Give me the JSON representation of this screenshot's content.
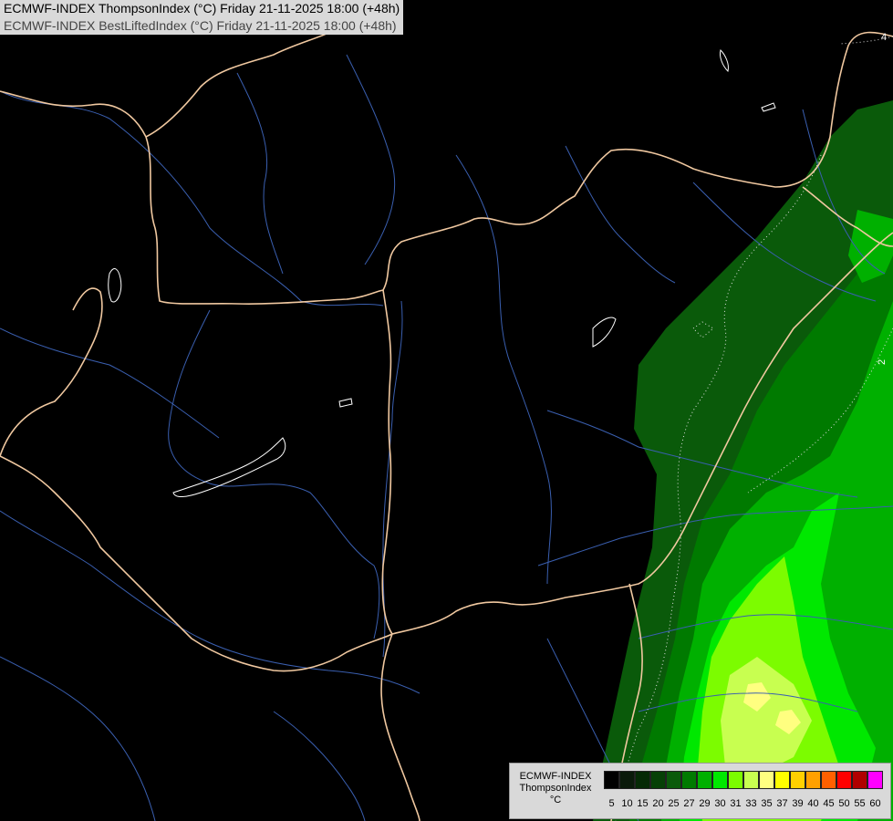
{
  "header": {
    "line1": "ECMWF-INDEX ThompsonIndex (°C) Friday 21-11-2025 18:00 (+48h)",
    "line2": "ECMWF-INDEX BestLiftedIndex (°C) Friday 21-11-2025 18:00 (+48h)"
  },
  "legend": {
    "title_line1": "ECMWF-INDEX",
    "title_line2": "ThompsonIndex",
    "unit": "°C",
    "colors": [
      "#000000",
      "#0a1a0a",
      "#052a05",
      "#064006",
      "#0a5a0a",
      "#007a00",
      "#00b000",
      "#00e800",
      "#7cfc00",
      "#c8ff50",
      "#ffff80",
      "#ffff00",
      "#ffd000",
      "#ffa000",
      "#ff6000",
      "#ff0000",
      "#b00000",
      "#ff00ff",
      "#c000ff",
      "#8000ff",
      "#4020ff",
      "#0000ff"
    ],
    "ticks": [
      "5",
      "10",
      "15",
      "20",
      "25",
      "27",
      "29",
      "30",
      "31",
      "33",
      "35",
      "37",
      "39",
      "40",
      "45",
      "50",
      "55",
      "60"
    ]
  },
  "contour_labels": {
    "top_right": "4",
    "right": "2"
  }
}
